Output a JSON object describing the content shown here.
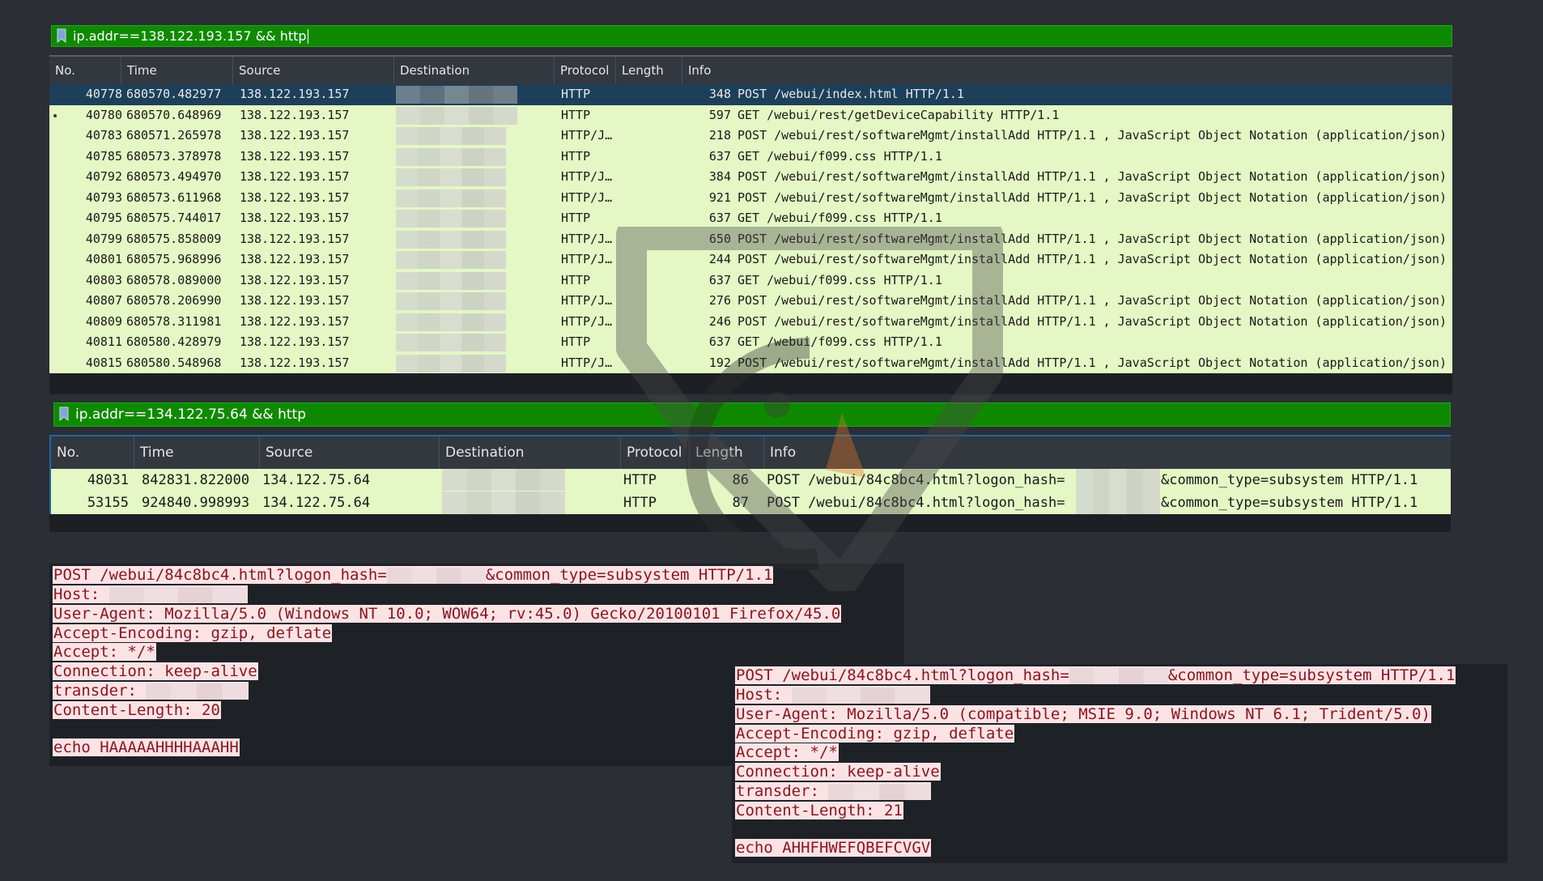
{
  "panel1": {
    "filter": "ip.addr==138.122.193.157 && http",
    "columns": [
      "No.",
      "Time",
      "Source",
      "Destination",
      "Protocol",
      "Length",
      "Info"
    ],
    "rows": [
      {
        "no": "40778",
        "time": "680570.482977",
        "src": "138.122.193.157",
        "proto": "HTTP",
        "len": "348",
        "info": "POST /webui/index.html HTTP/1.1"
      },
      {
        "no": "40780",
        "time": "680570.648969",
        "src": "138.122.193.157",
        "proto": "HTTP",
        "len": "597",
        "info": "GET /webui/rest/getDeviceCapability HTTP/1.1"
      },
      {
        "no": "40783",
        "time": "680571.265978",
        "src": "138.122.193.157",
        "proto": "HTTP/J…",
        "len": "218",
        "info": "POST /webui/rest/softwareMgmt/installAdd HTTP/1.1 , JavaScript Object Notation (application/json)"
      },
      {
        "no": "40785",
        "time": "680573.378978",
        "src": "138.122.193.157",
        "proto": "HTTP",
        "len": "637",
        "info": "GET /webui/f099.css HTTP/1.1"
      },
      {
        "no": "40792",
        "time": "680573.494970",
        "src": "138.122.193.157",
        "proto": "HTTP/J…",
        "len": "384",
        "info": "POST /webui/rest/softwareMgmt/installAdd HTTP/1.1 , JavaScript Object Notation (application/json)"
      },
      {
        "no": "40793",
        "time": "680573.611968",
        "src": "138.122.193.157",
        "proto": "HTTP/J…",
        "len": "921",
        "info": "POST /webui/rest/softwareMgmt/installAdd HTTP/1.1 , JavaScript Object Notation (application/json)"
      },
      {
        "no": "40795",
        "time": "680575.744017",
        "src": "138.122.193.157",
        "proto": "HTTP",
        "len": "637",
        "info": "GET /webui/f099.css HTTP/1.1"
      },
      {
        "no": "40799",
        "time": "680575.858009",
        "src": "138.122.193.157",
        "proto": "HTTP/J…",
        "len": "650",
        "info": "POST /webui/rest/softwareMgmt/installAdd HTTP/1.1 , JavaScript Object Notation (application/json)"
      },
      {
        "no": "40801",
        "time": "680575.968996",
        "src": "138.122.193.157",
        "proto": "HTTP/J…",
        "len": "244",
        "info": "POST /webui/rest/softwareMgmt/installAdd HTTP/1.1 , JavaScript Object Notation (application/json)"
      },
      {
        "no": "40803",
        "time": "680578.089000",
        "src": "138.122.193.157",
        "proto": "HTTP",
        "len": "637",
        "info": "GET /webui/f099.css HTTP/1.1"
      },
      {
        "no": "40807",
        "time": "680578.206990",
        "src": "138.122.193.157",
        "proto": "HTTP/J…",
        "len": "276",
        "info": "POST /webui/rest/softwareMgmt/installAdd HTTP/1.1 , JavaScript Object Notation (application/json)"
      },
      {
        "no": "40809",
        "time": "680578.311981",
        "src": "138.122.193.157",
        "proto": "HTTP/J…",
        "len": "246",
        "info": "POST /webui/rest/softwareMgmt/installAdd HTTP/1.1 , JavaScript Object Notation (application/json)"
      },
      {
        "no": "40811",
        "time": "680580.428979",
        "src": "138.122.193.157",
        "proto": "HTTP",
        "len": "637",
        "info": "GET /webui/f099.css HTTP/1.1"
      },
      {
        "no": "40815",
        "time": "680580.548968",
        "src": "138.122.193.157",
        "proto": "HTTP/J…",
        "len": "192",
        "info": "POST /webui/rest/softwareMgmt/installAdd HTTP/1.1 , JavaScript Object Notation (application/json)"
      }
    ]
  },
  "panel2": {
    "filter": "ip.addr==134.122.75.64 && http",
    "columns": [
      "No.",
      "Time",
      "Source",
      "Destination",
      "Protocol",
      "Length",
      "Info"
    ],
    "rows": [
      {
        "no": "48031",
        "time": "842831.822000",
        "src": "134.122.75.64",
        "proto": "HTTP",
        "len": "86",
        "info_a": "POST /webui/84c8bc4.html?logon_hash=",
        "info_b": "&common_type=subsystem HTTP/1.1"
      },
      {
        "no": "53155",
        "time": "924840.998993",
        "src": "134.122.75.64",
        "proto": "HTTP",
        "len": "87",
        "info_a": "POST /webui/84c8bc4.html?logon_hash=",
        "info_b": "&common_type=subsystem HTTP/1.1"
      }
    ]
  },
  "request1": {
    "line1a": "POST /webui/84c8bc4.html?logon_hash=",
    "line1b": "&common_type=subsystem HTTP/1.1",
    "host": "Host: ",
    "ua": "User-Agent: Mozilla/5.0 (Windows NT 10.0; WOW64; rv:45.0) Gecko/20100101 Firefox/45.0",
    "enc": "Accept-Encoding: gzip, deflate",
    "accept": "Accept: */*",
    "conn": "Connection: keep-alive",
    "transder": "transder: ",
    "clen": "Content-Length: 20",
    "body": "echo HAAAAAHHHHAAAHH"
  },
  "request2": {
    "line1a": "POST /webui/84c8bc4.html?logon_hash=",
    "line1b": "&common_type=subsystem HTTP/1.1",
    "host": "Host: ",
    "ua": "User-Agent: Mozilla/5.0 (compatible; MSIE 9.0; Windows NT 6.1; Trident/5.0)",
    "enc": "Accept-Encoding: gzip, deflate",
    "accept": "Accept: */*",
    "conn": "Connection: keep-alive",
    "transder": "transder: ",
    "clen": "Content-Length: 21",
    "body": "echo AHHFHWEFQBEFCVGV"
  }
}
